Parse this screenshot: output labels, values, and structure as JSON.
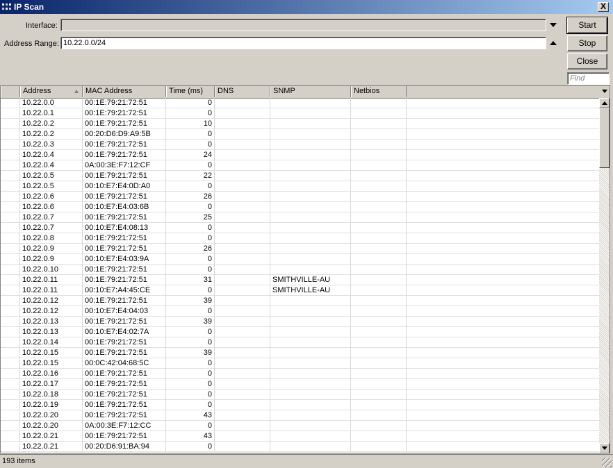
{
  "window": {
    "title": "IP Scan",
    "close_glyph": "X"
  },
  "form": {
    "interface_label": "Interface:",
    "interface_value": "",
    "address_range_label": "Address Range:",
    "address_range_value": "10.22.0.0/24"
  },
  "buttons": {
    "start": "Start",
    "stop": "Stop",
    "close": "Close"
  },
  "find": {
    "placeholder": "Find"
  },
  "columns": [
    "Address",
    "MAC Address",
    "Time (ms)",
    "DNS",
    "SNMP",
    "Netbios"
  ],
  "rows": [
    [
      "10.22.0.0",
      "00:1E:79:21:72:51",
      "0",
      "",
      "",
      ""
    ],
    [
      "10.22.0.1",
      "00:1E:79:21:72:51",
      "0",
      "",
      "",
      ""
    ],
    [
      "10.22.0.2",
      "00:1E:79:21:72:51",
      "10",
      "",
      "",
      ""
    ],
    [
      "10.22.0.2",
      "00:20:D6:D9:A9:5B",
      "0",
      "",
      "",
      ""
    ],
    [
      "10.22.0.3",
      "00:1E:79:21:72:51",
      "0",
      "",
      "",
      ""
    ],
    [
      "10.22.0.4",
      "00:1E:79:21:72:51",
      "24",
      "",
      "",
      ""
    ],
    [
      "10.22.0.4",
      "0A:00:3E:F7:12:CF",
      "0",
      "",
      "",
      ""
    ],
    [
      "10.22.0.5",
      "00:1E:79:21:72:51",
      "22",
      "",
      "",
      ""
    ],
    [
      "10.22.0.5",
      "00:10:E7:E4:0D:A0",
      "0",
      "",
      "",
      ""
    ],
    [
      "10.22.0.6",
      "00:1E:79:21:72:51",
      "26",
      "",
      "",
      ""
    ],
    [
      "10.22.0.6",
      "00:10:E7:E4:03:6B",
      "0",
      "",
      "",
      ""
    ],
    [
      "10.22.0.7",
      "00:1E:79:21:72:51",
      "25",
      "",
      "",
      ""
    ],
    [
      "10.22.0.7",
      "00:10:E7:E4:08:13",
      "0",
      "",
      "",
      ""
    ],
    [
      "10.22.0.8",
      "00:1E:79:21:72:51",
      "0",
      "",
      "",
      ""
    ],
    [
      "10.22.0.9",
      "00:1E:79:21:72:51",
      "26",
      "",
      "",
      ""
    ],
    [
      "10.22.0.9",
      "00:10:E7:E4:03:9A",
      "0",
      "",
      "",
      ""
    ],
    [
      "10.22.0.10",
      "00:1E:79:21:72:51",
      "0",
      "",
      "",
      ""
    ],
    [
      "10.22.0.11",
      "00:1E:79:21:72:51",
      "31",
      "",
      "SMITHVILLE-AU",
      ""
    ],
    [
      "10.22.0.11",
      "00:10:E7:A4:45:CE",
      "0",
      "",
      "SMITHVILLE-AU",
      ""
    ],
    [
      "10.22.0.12",
      "00:1E:79:21:72:51",
      "39",
      "",
      "",
      ""
    ],
    [
      "10.22.0.12",
      "00:10:E7:E4:04:03",
      "0",
      "",
      "",
      ""
    ],
    [
      "10.22.0.13",
      "00:1E:79:21:72:51",
      "39",
      "",
      "",
      ""
    ],
    [
      "10.22.0.13",
      "00:10:E7:E4:02:7A",
      "0",
      "",
      "",
      ""
    ],
    [
      "10.22.0.14",
      "00:1E:79:21:72:51",
      "0",
      "",
      "",
      ""
    ],
    [
      "10.22.0.15",
      "00:1E:79:21:72:51",
      "39",
      "",
      "",
      ""
    ],
    [
      "10.22.0.15",
      "00:0C:42:04:68:5C",
      "0",
      "",
      "",
      ""
    ],
    [
      "10.22.0.16",
      "00:1E:79:21:72:51",
      "0",
      "",
      "",
      ""
    ],
    [
      "10.22.0.17",
      "00:1E:79:21:72:51",
      "0",
      "",
      "",
      ""
    ],
    [
      "10.22.0.18",
      "00:1E:79:21:72:51",
      "0",
      "",
      "",
      ""
    ],
    [
      "10.22.0.19",
      "00:1E:79:21:72:51",
      "0",
      "",
      "",
      ""
    ],
    [
      "10.22.0.20",
      "00:1E:79:21:72:51",
      "43",
      "",
      "",
      ""
    ],
    [
      "10.22.0.20",
      "0A:00:3E:F7:12:CC",
      "0",
      "",
      "",
      ""
    ],
    [
      "10.22.0.21",
      "00:1E:79:21:72:51",
      "43",
      "",
      "",
      ""
    ],
    [
      "10.22.0.21",
      "00:20:D6:91:BA:94",
      "0",
      "",
      "",
      ""
    ]
  ],
  "status": {
    "items_text": "193 items"
  },
  "colors": {
    "titlebar_start": "#0a246a",
    "titlebar_end": "#a6caf0",
    "window_bg": "#d4d0c8"
  }
}
